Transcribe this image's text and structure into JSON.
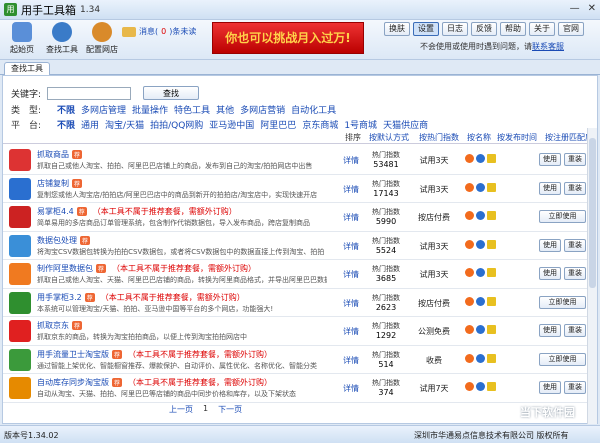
{
  "window": {
    "title": "用手工具箱",
    "version": "1.34",
    "minimize": "—",
    "close": "✕"
  },
  "toolbar": {
    "items": [
      {
        "label": "起始页"
      },
      {
        "label": "查找工具"
      },
      {
        "label": "配置网店"
      }
    ],
    "message_prefix": "消息(",
    "message_count": "0",
    "message_suffix": ")条未读",
    "banner": "你也可以挑战月入过万!",
    "buttons": [
      "换肤",
      "设置",
      "日志",
      "反馈",
      "帮助",
      "关于",
      "官网"
    ],
    "notice_text": "不会使用或使用时遇到问题，请",
    "notice_link": "联系客服"
  },
  "tab": {
    "label": "查找工具"
  },
  "search": {
    "label": "关键字:",
    "placeholder": "",
    "button": "查找"
  },
  "filters": {
    "type_label": "类　型:",
    "types": [
      "不限",
      "多网店管理",
      "批量操作",
      "特色工具",
      "其他",
      "多网店营销",
      "自动化工具"
    ],
    "platform_label": "平　台:",
    "platforms": [
      "不限",
      "通用",
      "淘宝/天猫",
      "拍拍/QQ网购",
      "亚马逊中国",
      "阿里巴巴",
      "京东商城",
      "1号商城",
      "天猫供应商"
    ]
  },
  "sort": {
    "label": "排序",
    "by_auth": "按默认方式",
    "by_popular": "按热门指数",
    "by_name": "按名称",
    "by_time": "按发布时间",
    "by_match": "按注册匹配度"
  },
  "tools": [
    {
      "name": "抓取商品",
      "badge": "荐",
      "warn": "",
      "desc": "抓取自己或他人淘宝、拍拍、阿里巴巴店铺上的商品，发布到自己的淘宝/拍拍网店中出售",
      "pop_label": "热门指数",
      "pop": "53481",
      "fee": "试用3天",
      "btn1": "使用",
      "btn2": "重装",
      "color": "#d33"
    },
    {
      "name": "店铺复制",
      "badge": "荐",
      "warn": "",
      "desc": "复制您或他人淘宝店/拍拍店/阿里巴巴店中的商品到新开的拍拍店/淘宝店中，实现快速开店",
      "pop_label": "热门指数",
      "pop": "17143",
      "fee": "试用3天",
      "btn1": "使用",
      "btn2": "重装",
      "color": "#2a6fd0"
    },
    {
      "name": "易掌柜4.4",
      "badge": "荐",
      "warn": "（本工具不属于推荐套餐，需额外订购）",
      "desc": "简单易用的多店商品订单管理系统，包含制作代销数据包，导入发布商品，跨店复制商品",
      "pop_label": "热门指数",
      "pop": "5990",
      "fee": "按店付费",
      "btn1": "立即使用",
      "btn2": "",
      "color": "#c22"
    },
    {
      "name": "数据包处理",
      "badge": "荐",
      "warn": "",
      "desc": "将淘宝CSV数据包转换为拍拍CSV数据包，或者将CSV数据包中的数据直接上传到淘宝、拍拍",
      "pop_label": "热门指数",
      "pop": "5524",
      "fee": "试用3天",
      "btn1": "使用",
      "btn2": "重装",
      "color": "#3a8fd8"
    },
    {
      "name": "制作阿里数据包",
      "badge": "荐",
      "warn": "（本工具不属于推荐套餐，需额外订购）",
      "desc": "抓取自己或他人淘宝、天猫、阿里巴巴店铺的商品，转换为阿里商品格式，并导出阿里巴巴数据包",
      "pop_label": "热门指数",
      "pop": "3685",
      "fee": "试用3天",
      "btn1": "使用",
      "btn2": "重装",
      "color": "#f07a20"
    },
    {
      "name": "用手掌柜3.2",
      "badge": "荐",
      "warn": "（本工具不属于推荐套餐，需额外订购）",
      "desc": "本系统可以管理淘宝/天猫、拍拍、亚马逊中国等平台的多个网店，功能强大!",
      "pop_label": "热门指数",
      "pop": "2623",
      "fee": "按店付费",
      "btn1": "立即使用",
      "btn2": "",
      "color": "#2f8f2f"
    },
    {
      "name": "抓取京东",
      "badge": "荐",
      "warn": "",
      "desc": "抓取京东的商品，转换为淘宝拍拍商品，以便上传到淘宝拍拍网店中",
      "pop_label": "热门指数",
      "pop": "1292",
      "fee": "公测免费",
      "btn1": "使用",
      "btn2": "重装",
      "color": "#e02020"
    },
    {
      "name": "用手流量卫士淘宝版",
      "badge": "荐",
      "warn": "（本工具不属于推荐套餐，需额外订购）",
      "desc": "通过智能上架优化、智能橱窗推荐、爆款保护、自动评价、属性优化、名称优化、智能分类",
      "pop_label": "热门指数",
      "pop": "514",
      "fee": "收费",
      "btn1": "立即使用",
      "btn2": "",
      "color": "#3b9a3b"
    },
    {
      "name": "自动库存同步淘宝版",
      "badge": "荐",
      "warn": "（本工具不属于推荐套餐，需额外订购）",
      "desc": "自动从淘宝、天猫、拍拍、阿里巴巴等店铺的商品中同步价格和库存，以及下架状态",
      "pop_label": "热门指数",
      "pop": "374",
      "fee": "试用7天",
      "btn1": "使用",
      "btn2": "重装",
      "color": "#e68a00"
    }
  ],
  "detail_label": "详情",
  "pager": {
    "prev": "上一页",
    "current": "1",
    "next": "下一页"
  },
  "status": {
    "version": "版本号1.34.02",
    "copyright": "深圳市华通易点信息技术有限公司 版权所有"
  },
  "watermark": "当下软件园"
}
